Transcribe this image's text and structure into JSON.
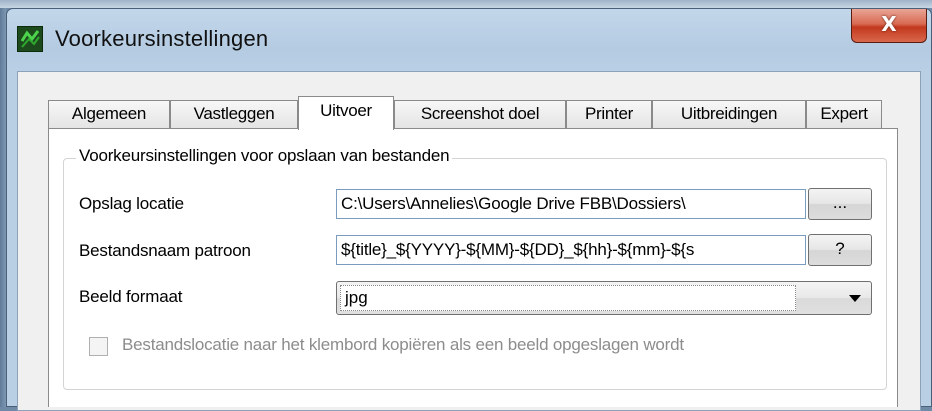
{
  "window": {
    "title": "Voorkeursinstellingen",
    "close_label": "X"
  },
  "tabs": [
    {
      "label": "Algemeen",
      "active": false
    },
    {
      "label": "Vastleggen",
      "active": false
    },
    {
      "label": "Uitvoer",
      "active": true
    },
    {
      "label": "Screenshot doel",
      "active": false
    },
    {
      "label": "Printer",
      "active": false
    },
    {
      "label": "Uitbreidingen",
      "active": false
    },
    {
      "label": "Expert",
      "active": false
    }
  ],
  "group": {
    "legend": "Voorkeursinstellingen voor opslaan van bestanden"
  },
  "storage": {
    "label": "Opslag locatie",
    "value": "C:\\Users\\Annelies\\Google Drive FBB\\Dossiers\\",
    "browse_label": "..."
  },
  "pattern": {
    "label": "Bestandsnaam patroon",
    "value": "${title}_${YYYY}-${MM}-${DD}_${hh}-${mm}-${s",
    "help_label": "?"
  },
  "format": {
    "label": "Beeld formaat",
    "selected": "jpg"
  },
  "clipboard": {
    "label": "Bestandslocatie naar het klembord kopiëren als een beeld opgeslagen wordt",
    "checked": false,
    "enabled": false
  },
  "icons": {
    "app": "greenshot-icon",
    "close": "close-icon",
    "dropdown": "chevron-down-icon"
  }
}
